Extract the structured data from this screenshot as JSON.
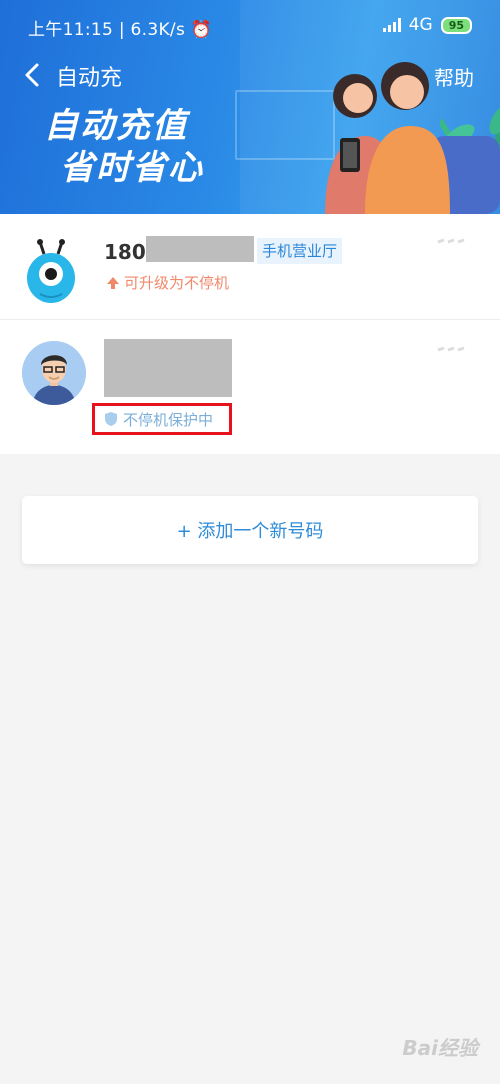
{
  "status_bar": {
    "time": "上午11:15",
    "speed": "6.3K/s",
    "network": "4G",
    "battery": "95"
  },
  "header": {
    "title": "自动充",
    "help_label": "帮助",
    "slogan_line1": "自动充值",
    "slogan_line2": "省时省心"
  },
  "accounts": [
    {
      "number_prefix": "180",
      "tag": "手机营业厅",
      "status": "可升级为不停机"
    },
    {
      "status": "不停机保护中"
    }
  ],
  "add_button_label": "+ 添加一个新号码",
  "watermark": "Bai经验",
  "colors": {
    "banner": "#2a8ae6",
    "accent": "#2e8bd7",
    "upgrade": "#f0896b",
    "highlight_border": "#e8121c"
  }
}
